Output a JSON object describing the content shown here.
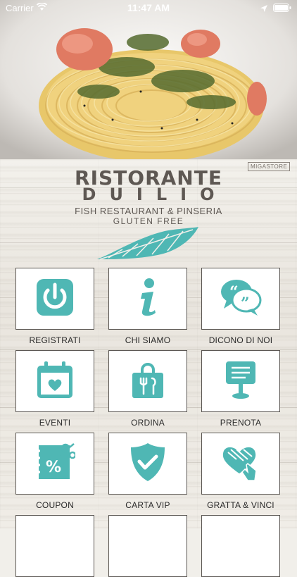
{
  "status_bar": {
    "carrier": "Carrier",
    "time": "11:47 AM"
  },
  "header": {
    "brand_badge": "MIGASTORE",
    "title": "RISTORANTE",
    "name": "DUILIO",
    "subtitle": "FISH RESTAURANT & PINSERIA",
    "tagline": "GLUTEN FREE"
  },
  "colors": {
    "accent": "#4fb7b4",
    "text": "#2a2a2a",
    "logo": "#5e5853"
  },
  "menu": [
    {
      "label": "REGISTRATI",
      "icon": "power-icon"
    },
    {
      "label": "CHI SIAMO",
      "icon": "info-icon"
    },
    {
      "label": "DICONO DI NOI",
      "icon": "quote-chat-icon"
    },
    {
      "label": "EVENTI",
      "icon": "calendar-heart-icon"
    },
    {
      "label": "ORDINA",
      "icon": "shopping-bag-cutlery-icon"
    },
    {
      "label": "PRENOTA",
      "icon": "reservation-sign-icon"
    },
    {
      "label": "COUPON",
      "icon": "coupon-percent-icon"
    },
    {
      "label": "CARTA VIP",
      "icon": "shield-check-icon"
    },
    {
      "label": "GRATTA & VINCI",
      "icon": "scratch-card-icon"
    }
  ]
}
